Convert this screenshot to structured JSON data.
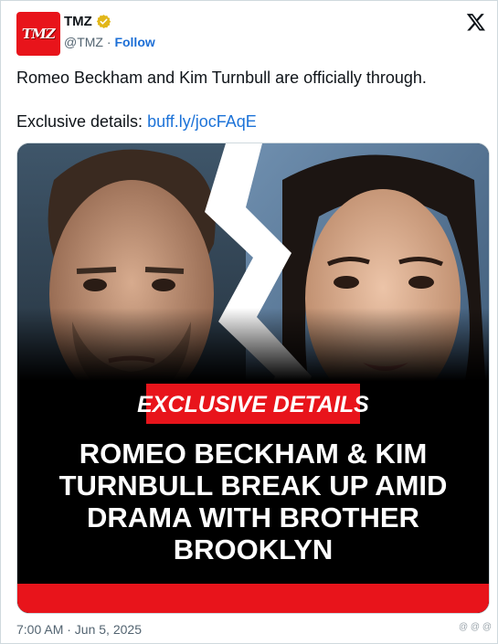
{
  "tweet": {
    "author_name": "TMZ",
    "handle": "@TMZ",
    "separator": "·",
    "follow_label": "Follow",
    "avatar_text": "TMZ",
    "text_line1": "Romeo Beckham and Kim Turnbull are officially through.",
    "text_line2_prefix": "Exclusive details: ",
    "link_text": "buff.ly/jocFAqE",
    "timestamp": "7:00 AM · Jun 5, 2025"
  },
  "media": {
    "banner_label": "EXCLUSIVE DETAILS",
    "headline_lines": [
      "ROMEO BECKHAM & KIM",
      "TURNBULL BREAK UP AMID",
      "DRAMA WITH BROTHER",
      "BROOKLYN"
    ]
  },
  "colors": {
    "brand_red": "#e8141b",
    "link_blue": "#1d73d8",
    "verified_gold": "#e2b719"
  },
  "icons": {
    "verified": "verified-badge-icon",
    "platform": "x-logo-icon"
  },
  "watermark": "@ @ @"
}
